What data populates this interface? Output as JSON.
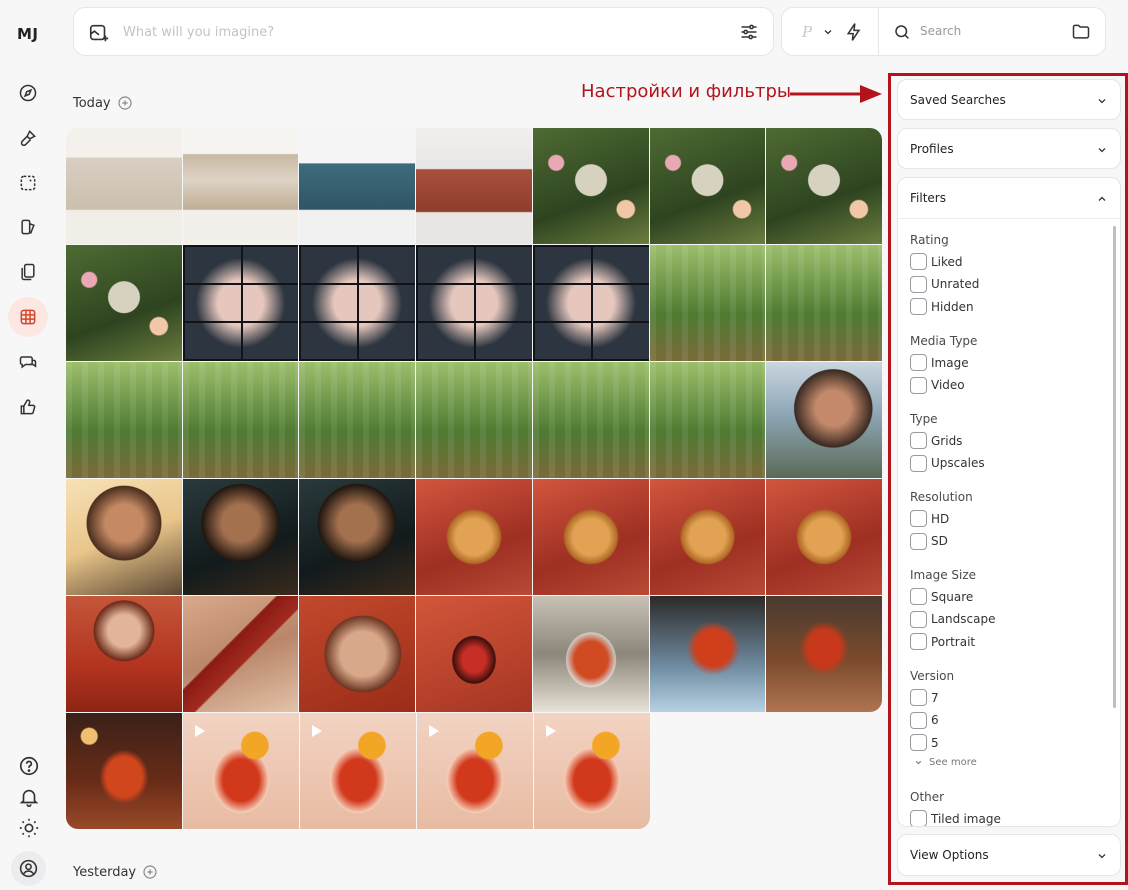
{
  "app": {
    "logo": "MJ"
  },
  "prompt": {
    "placeholder": "What will you imagine?"
  },
  "toolbar": {
    "personalize_glyph": "P",
    "search_label": "Search"
  },
  "sections": {
    "today": "Today",
    "yesterday": "Yesterday"
  },
  "annotation": {
    "text": "Настройки и фильтры"
  },
  "panel": {
    "saved_searches": "Saved Searches",
    "profiles": "Profiles",
    "filters": "Filters",
    "view_options": "View Options",
    "groups": {
      "rating": {
        "label": "Rating",
        "options": [
          "Liked",
          "Unrated",
          "Hidden"
        ]
      },
      "media_type": {
        "label": "Media Type",
        "options": [
          "Image",
          "Video"
        ]
      },
      "type": {
        "label": "Type",
        "options": [
          "Grids",
          "Upscales"
        ]
      },
      "resolution": {
        "label": "Resolution",
        "options": [
          "HD",
          "SD"
        ]
      },
      "image_size": {
        "label": "Image Size",
        "options": [
          "Square",
          "Landscape",
          "Portrait"
        ]
      },
      "version": {
        "label": "Version",
        "options": [
          "7",
          "6",
          "5"
        ],
        "see_more": "See more"
      },
      "other": {
        "label": "Other",
        "options": [
          "Tiled image"
        ]
      }
    }
  },
  "colors": {
    "accent": "#b3141b",
    "active_nav_bg": "#fde7e3"
  },
  "tiles": [
    [
      "sofa-cream",
      "sofa-ornate",
      "sofa-blue",
      "sofa-rust",
      "garden-computer",
      "garden-computer",
      "garden-computer"
    ],
    [
      "garden-computer",
      "portrait-grid",
      "portrait-grid",
      "portrait-grid",
      "portrait-grid",
      "green-reader",
      "green-reader"
    ],
    [
      "green-reader",
      "green-reader",
      "green-reader",
      "green-reader",
      "green-reader",
      "green-reader",
      "woman-sunset"
    ],
    [
      "woman-coffee",
      "woman-coffee-dark",
      "woman-coffee-dark",
      "croissant",
      "croissant",
      "croissant",
      "croissant"
    ],
    [
      "woman-red",
      "phone-red",
      "phone-face",
      "phone-lips",
      "cocktail-bar",
      "cocktail-ice",
      "cocktail-wood"
    ],
    [
      "cocktail-bokeh",
      "cocktail-video",
      "cocktail-video",
      "cocktail-video",
      "cocktail-video"
    ]
  ]
}
